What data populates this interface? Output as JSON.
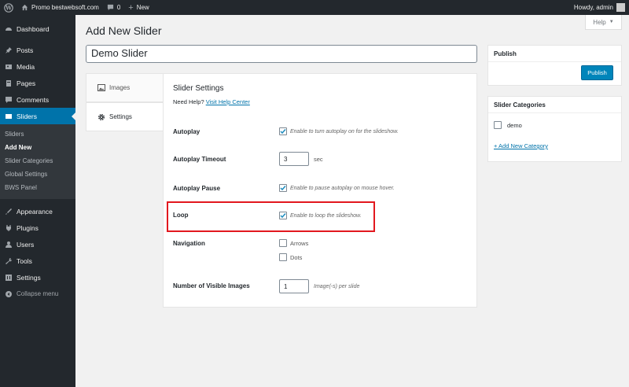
{
  "admin_bar": {
    "site_name": "Promo bestwebsoft.com",
    "comments_count": "0",
    "new_label": "New",
    "greeting": "Howdy, admin"
  },
  "help_tab": {
    "label": "Help"
  },
  "sidebar": {
    "items_top": [
      {
        "label": "Dashboard",
        "icon": "dashboard-icon"
      },
      {
        "label": "Posts",
        "icon": "pin-icon"
      },
      {
        "label": "Media",
        "icon": "media-icon"
      },
      {
        "label": "Pages",
        "icon": "pages-icon"
      },
      {
        "label": "Comments",
        "icon": "comments-icon"
      },
      {
        "label": "Sliders",
        "icon": "sliders-icon"
      }
    ],
    "submenu": [
      "Sliders",
      "Add New",
      "Slider Categories",
      "Global Settings",
      "BWS Panel"
    ],
    "items_bottom": [
      {
        "label": "Appearance",
        "icon": "appearance-icon"
      },
      {
        "label": "Plugins",
        "icon": "plugins-icon"
      },
      {
        "label": "Users",
        "icon": "users-icon"
      },
      {
        "label": "Tools",
        "icon": "tools-icon"
      },
      {
        "label": "Settings",
        "icon": "settings-icon"
      },
      {
        "label": "Collapse menu",
        "icon": "collapse-icon"
      }
    ]
  },
  "page": {
    "title": "Add New Slider",
    "slider_title_value": "Demo Slider"
  },
  "tabs": [
    {
      "label": "Images",
      "icon": "image-icon"
    },
    {
      "label": "Settings",
      "icon": "gear-icon"
    }
  ],
  "settings": {
    "heading": "Slider Settings",
    "help_prefix": "Need Help?",
    "help_link": "Visit Help Center",
    "autoplay": {
      "label": "Autoplay",
      "checked": true,
      "desc": "Enable to turn autoplay on for the slideshow."
    },
    "autoplay_timeout": {
      "label": "Autoplay Timeout",
      "value": "3",
      "unit": "sec"
    },
    "autoplay_pause": {
      "label": "Autoplay Pause",
      "checked": true,
      "desc": "Enable to pause autoplay on mouse hover."
    },
    "loop": {
      "label": "Loop",
      "checked": true,
      "desc": "Enable to loop the slideshow."
    },
    "navigation": {
      "label": "Navigation",
      "arrows_label": "Arrows",
      "dots_label": "Dots"
    },
    "visible_images": {
      "label": "Number of Visible Images",
      "value": "1",
      "unit": "Image(-s) per slide"
    }
  },
  "publish": {
    "title": "Publish",
    "button": "Publish"
  },
  "categories": {
    "title": "Slider Categories",
    "item": "demo",
    "add_link": "+ Add New Category"
  },
  "colors": {
    "accent": "#0073aa",
    "highlight": "#e2181e",
    "sidebar_bg": "#23282d"
  }
}
